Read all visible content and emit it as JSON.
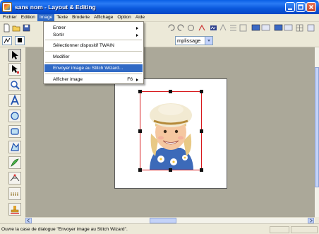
{
  "window": {
    "title": "sans nom - Layout & Editing"
  },
  "menubar": {
    "items": [
      "Fichier",
      "Edition",
      "Image",
      "Texte",
      "Broderie",
      "Affichage",
      "Option",
      "Aide"
    ],
    "active": "Image"
  },
  "image_menu": {
    "items": [
      {
        "label": "Entrer",
        "has_submenu": true
      },
      {
        "label": "Sortir",
        "has_submenu": true
      },
      {
        "label": "Sélectionner dispositif TWAIN",
        "has_submenu": false
      },
      {
        "label": "Modifier",
        "has_submenu": false
      },
      {
        "label": "Envoyer image au Stitch Wizard...",
        "has_submenu": false,
        "highlighted": true
      },
      {
        "label": "Afficher image",
        "shortcut": "F6",
        "has_submenu": true
      }
    ]
  },
  "toolbar2": {
    "fill_select_value": "mplissage"
  },
  "tools": [
    "select-arrow-icon",
    "point-edit-icon",
    "zoom-icon",
    "text-icon",
    "circle-icon",
    "rectangle-icon",
    "outline-icon",
    "brush-icon",
    "stitch-icon",
    "running-stitch-icon",
    "stamp-icon"
  ],
  "statusbar": {
    "message": "Ouvre la case de dialogue \"Envoyer image au Stitch Wizard\"."
  },
  "colors": {
    "menu_highlight": "#316ac5",
    "selection_border": "#d8191c",
    "workspace": "#aba899"
  }
}
